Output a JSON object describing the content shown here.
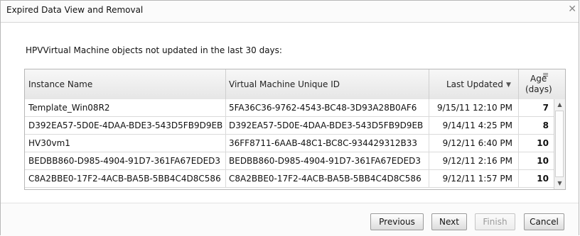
{
  "dialog": {
    "title": "Expired Data View and Removal",
    "close_icon": "close-icon",
    "description": "HPVVirtual Machine objects not updated in the last 30 days:"
  },
  "grid": {
    "columns": [
      {
        "label": "Instance Name"
      },
      {
        "label": "Virtual Machine Unique ID"
      },
      {
        "label": "Last Updated",
        "sort": "descending"
      },
      {
        "label": "Age",
        "sublabel": "(days)"
      }
    ],
    "rows": [
      {
        "instance": "Template_Win08R2",
        "uid": "5FA36C36-9762-4543-BC48-3D93A28B0AF6",
        "updated": "9/15/11 12:10 PM",
        "age": "7"
      },
      {
        "instance": "D392EA57-5D0E-4DAA-BDE3-543D5FB9D9EB",
        "uid": "D392EA57-5D0E-4DAA-BDE3-543D5FB9D9EB",
        "updated": "9/14/11 4:25 PM",
        "age": "8"
      },
      {
        "instance": "HV30vm1",
        "uid": "36FF8711-6AAB-48C1-BC8C-934429312B33",
        "updated": "9/12/11 6:40 PM",
        "age": "10"
      },
      {
        "instance": "BEDBB860-D985-4904-91D7-361FA67EDED3",
        "uid": "BEDBB860-D985-4904-91D7-361FA67EDED3",
        "updated": "9/12/11 2:16 PM",
        "age": "10"
      },
      {
        "instance": "C8A2BBE0-17F2-4ACB-BA5B-5BB4C4D8C586",
        "uid": "C8A2BBE0-17F2-4ACB-BA5B-5BB4C4D8C586",
        "updated": "9/12/11 1:57 PM",
        "age": "10"
      }
    ]
  },
  "footer": {
    "previous_label": "Previous",
    "next_label": "Next",
    "finish_label": "Finish",
    "cancel_label": "Cancel"
  }
}
